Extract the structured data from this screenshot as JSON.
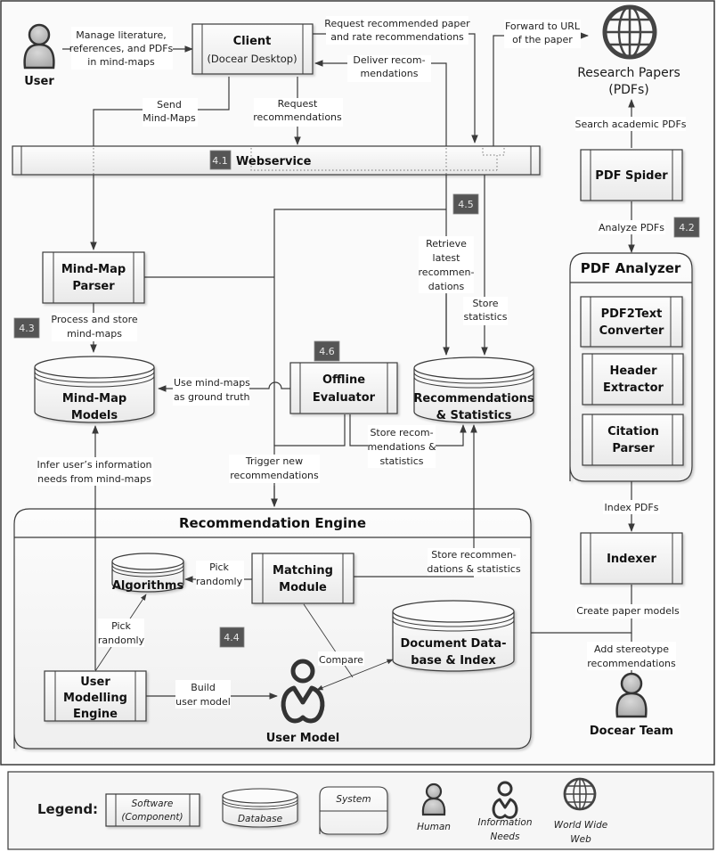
{
  "diagram": {
    "actors": {
      "user": {
        "label": "User",
        "icon": "human-icon"
      },
      "docear_team": {
        "label": "Docear Team",
        "icon": "human-icon"
      },
      "research_papers": {
        "label_line1": "Research Papers",
        "label_line2": "(PDFs)",
        "icon": "globe-icon"
      },
      "user_model": {
        "label": "User Model",
        "icon": "information-needs-icon"
      }
    },
    "components": {
      "client": {
        "title": "Client",
        "subtitle": "(Docear Desktop)"
      },
      "webservice": {
        "title": "Webservice",
        "badge": "4.1"
      },
      "pdf_spider": {
        "title": "PDF Spider"
      },
      "mind_map_parser": {
        "line1": "Mind-Map",
        "line2": "Parser"
      },
      "offline_evaluator": {
        "line1": "Offline",
        "line2": "Evaluator",
        "badge": "4.6"
      },
      "pdf2text": {
        "line1": "PDF2Text",
        "line2": "Converter"
      },
      "header_extractor": {
        "line1": "Header",
        "line2": "Extractor"
      },
      "citation_parser": {
        "line1": "Citation",
        "line2": "Parser"
      },
      "indexer": {
        "title": "Indexer"
      },
      "matching_module": {
        "line1": "Matching",
        "line2": "Module"
      },
      "user_modelling_engine": {
        "line1": "User",
        "line2": "Modelling",
        "line3": "Engine"
      }
    },
    "databases": {
      "mind_map_models": {
        "line1": "Mind-Map",
        "line2": "Models"
      },
      "recommendations_statistics": {
        "line1": "Recommendations",
        "line2": "& Statistics"
      },
      "algorithms": {
        "line1": "Algorithms"
      },
      "document_database": {
        "line1": "Document Data-",
        "line2": "base & Index"
      }
    },
    "systems": {
      "pdf_analyzer": {
        "title": "PDF Analyzer"
      },
      "recommendation_engine": {
        "title": "Recommendation Engine",
        "badge": "4.4"
      }
    },
    "badges": {
      "b42": "4.2",
      "b43": "4.3",
      "b45": "4.5"
    },
    "edges": {
      "manage": [
        "Manage literature,",
        "references, and PDFs",
        "in mind-maps"
      ],
      "request_paper": [
        "Request recommended paper",
        "and rate recommendations"
      ],
      "forward_url": [
        "Forward to URL",
        "of the paper"
      ],
      "deliver": [
        "Deliver recom-",
        "mendations"
      ],
      "send_mindmaps": [
        "Send",
        "Mind-Maps"
      ],
      "request_recs": [
        "Request",
        "recommendations"
      ],
      "search_pdfs": [
        "Search academic PDFs"
      ],
      "analyze_pdfs": [
        "Analyze PDFs"
      ],
      "retrieve_latest": [
        "Retrieve",
        "latest",
        "recommen-",
        "dations"
      ],
      "store_statistics": [
        "Store",
        "statistics"
      ],
      "process_store": [
        "Process and store",
        "mind-maps"
      ],
      "ground_truth": [
        "Use mind-maps",
        "as ground truth"
      ],
      "store_recs_eval": [
        "Store recom-",
        "mendations &",
        "statistics"
      ],
      "infer_needs": [
        "Infer user’s information",
        "needs from mind-maps"
      ],
      "trigger_new": [
        "Trigger new",
        "recommendations"
      ],
      "index_pdfs": [
        "Index PDFs"
      ],
      "store_recs_engine": [
        "Store recommen-",
        "dations & statistics"
      ],
      "pick_randomly_1": [
        "Pick",
        "randomly"
      ],
      "pick_randomly_2": [
        "Pick",
        "randomly"
      ],
      "create_paper_models": [
        "Create paper models"
      ],
      "add_stereotype": [
        "Add stereotype",
        "recommendations"
      ],
      "compare": [
        "Compare"
      ],
      "build_user_model": [
        "Build",
        "user model"
      ]
    }
  },
  "legend": {
    "title": "Legend:",
    "software": [
      "Software",
      "(Component)"
    ],
    "database": "Database",
    "system": "System",
    "human": "Human",
    "information_needs": [
      "Information",
      "Needs"
    ],
    "world_wide_web": [
      "World Wide",
      "Web"
    ]
  },
  "colors": {
    "badge_bg": "#555555",
    "stroke": "#3a3a3a",
    "panel_bg": "#f7f7f7"
  }
}
